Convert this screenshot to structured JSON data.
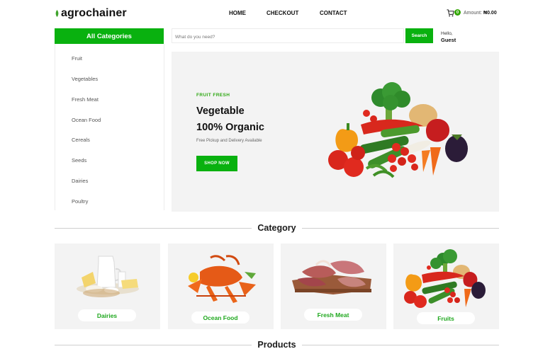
{
  "header": {
    "logo_text": "agrochainer",
    "nav": [
      "HOME",
      "CHECKOUT",
      "CONTACT"
    ],
    "cart_count": "0",
    "amount_label": "Amount:",
    "amount_value": "₦0.00"
  },
  "sidebar": {
    "title": "All Categories",
    "items": [
      "Fruit",
      "Vegetables",
      "Fresh Meat",
      "Ocean Food",
      "Cereals",
      "Seeds",
      "Dairies",
      "Poultry"
    ]
  },
  "search": {
    "placeholder": "What do you need?",
    "button": "Search"
  },
  "user": {
    "hello": "Hello,",
    "name": "Guest"
  },
  "hero": {
    "kicker": "FRUIT FRESH",
    "title_line1": "Vegetable",
    "title_line2": "100% Organic",
    "subtitle": "Free Pickup and Delivery Available",
    "button": "SHOP NOW"
  },
  "category_section": {
    "title": "Category",
    "cards": [
      "Dairies",
      "Ocean Food",
      "Fresh Meat",
      "Fruits"
    ]
  },
  "products_section": {
    "title": "Products"
  },
  "colors": {
    "accent": "#09b10f",
    "panel": "#f3f3f3",
    "text": "#1c1c1c"
  }
}
